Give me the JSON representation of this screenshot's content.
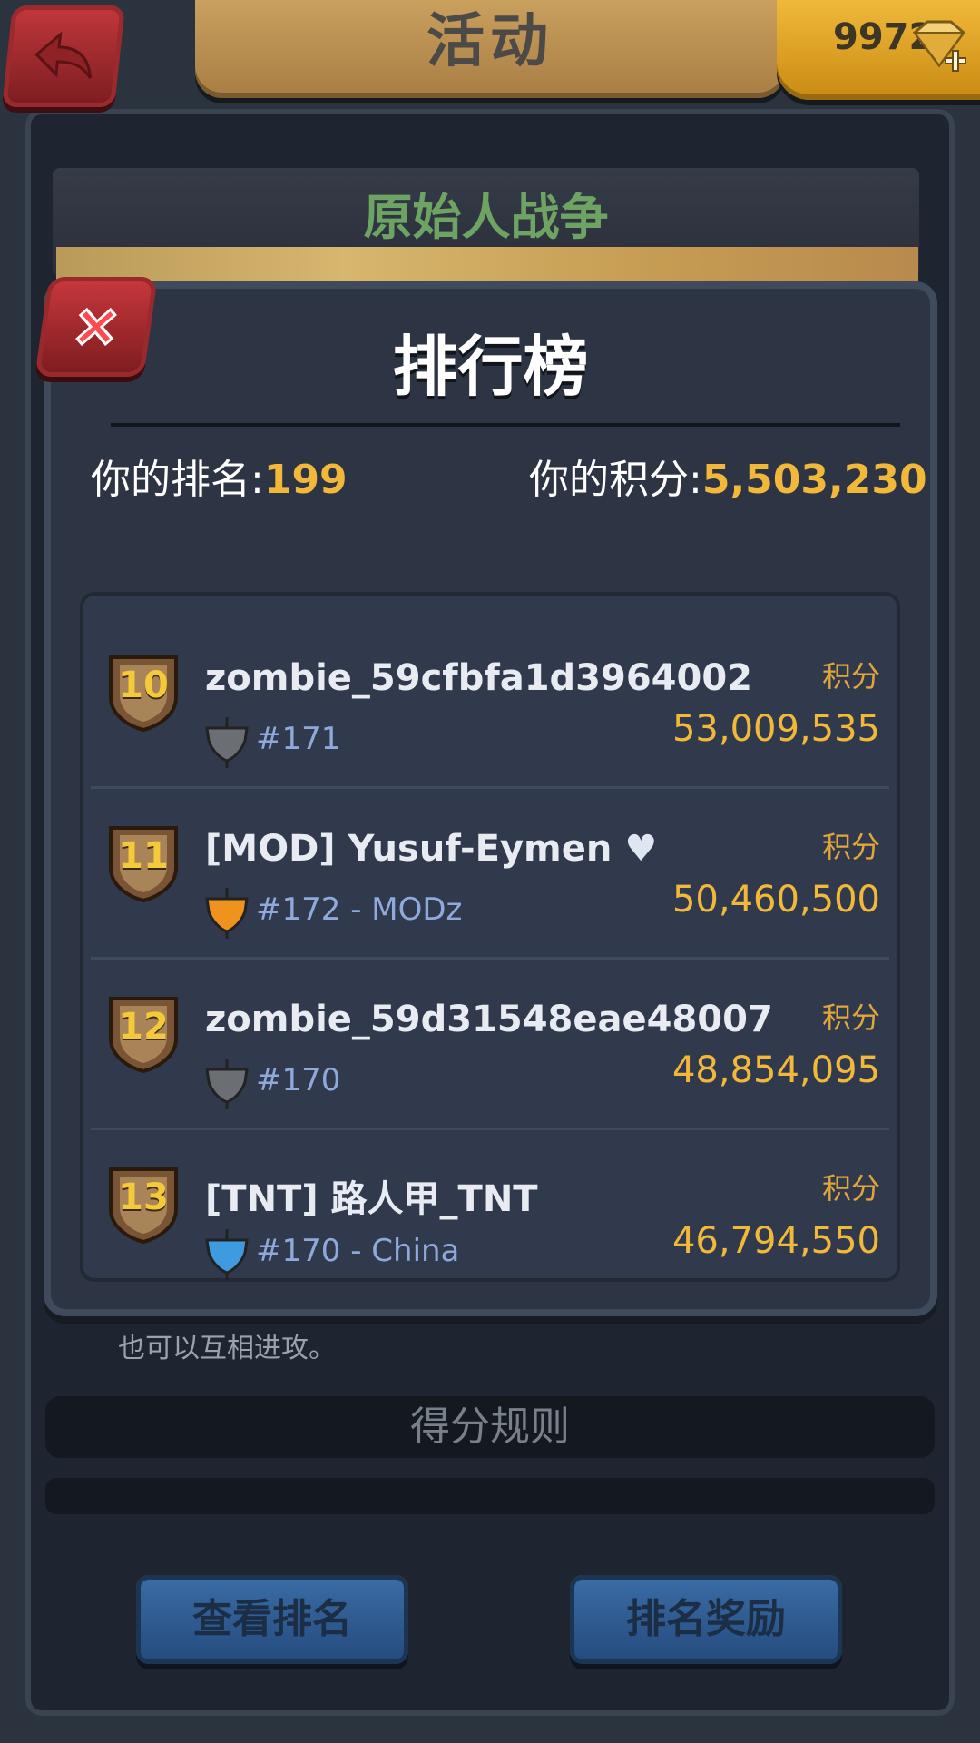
{
  "header": {
    "title": "活动",
    "gems": "9972"
  },
  "event": {
    "title": "原始人战争",
    "desc_tail": "也可以互相进攻。",
    "rules_label": "得分规则"
  },
  "bottom_buttons": {
    "view_rank": "查看排名",
    "rank_rewards": "排名奖励"
  },
  "leaderboard": {
    "title": "排行榜",
    "your_rank_label": "你的排名:",
    "your_rank": "199",
    "your_score_label": "你的积分:",
    "your_score": "5,503,230",
    "rows": [
      {
        "rank": "10",
        "name": "zombie_59cfbfa1d3964002",
        "clan_rank": "#171",
        "clan": "",
        "score_label": "积分",
        "score": "53,009,535",
        "flag_color": "#6b6e73"
      },
      {
        "rank": "11",
        "name": "[MOD] Yusuf-Eymen",
        "clan_rank": "#172",
        "clan": " - MODz",
        "score_label": "积分",
        "score": "50,460,500",
        "flag_color": "#f0921e",
        "heart": "♥"
      },
      {
        "rank": "12",
        "name": "zombie_59d31548eae48007",
        "clan_rank": "#170",
        "clan": "",
        "score_label": "积分",
        "score": "48,854,095",
        "flag_color": "#6b6e73"
      },
      {
        "rank": "13",
        "name": "[TNT] 路人甲_TNT",
        "clan_rank": "#170",
        "clan": " - China",
        "score_label": "积分",
        "score": "46,794,550",
        "flag_color": "#3f9be0"
      }
    ]
  }
}
